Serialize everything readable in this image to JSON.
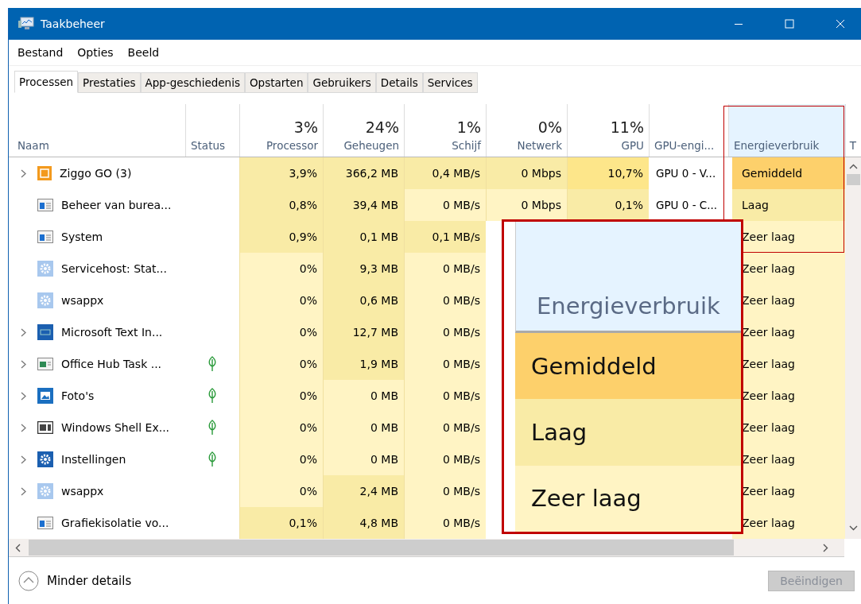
{
  "window": {
    "title": "Taakbeheer"
  },
  "menu": [
    "Bestand",
    "Opties",
    "Beeld"
  ],
  "tabs": [
    {
      "label": "Processen",
      "selected": true
    },
    {
      "label": "Prestaties",
      "selected": false
    },
    {
      "label": "App-geschiedenis",
      "selected": false
    },
    {
      "label": "Opstarten",
      "selected": false
    },
    {
      "label": "Gebruikers",
      "selected": false
    },
    {
      "label": "Details",
      "selected": false
    },
    {
      "label": "Services",
      "selected": false
    }
  ],
  "columns": [
    {
      "label": "Naam",
      "selected": false
    },
    {
      "label": "Status",
      "selected": false
    },
    {
      "label": "Processor",
      "total": "3%",
      "selected": false
    },
    {
      "label": "Geheugen",
      "total": "24%",
      "selected": false
    },
    {
      "label": "Schijf",
      "total": "1%",
      "selected": false
    },
    {
      "label": "Netwerk",
      "total": "0%",
      "selected": false
    },
    {
      "label": "GPU",
      "total": "11%",
      "selected": false
    },
    {
      "label": "GPU-engi...",
      "selected": false
    },
    {
      "label": "Energieverbruik",
      "selected": true
    },
    {
      "label": "T",
      "selected": false
    }
  ],
  "rows": [
    {
      "name": "Ziggo GO (3)",
      "kind": "ziggo",
      "expandable": true,
      "suspended": false,
      "processor": {
        "text": "3,9%",
        "color": "#f9eba6"
      },
      "memory": {
        "text": "366,2 MB",
        "color": "#f9eba6"
      },
      "disk": {
        "text": "0,4 MB/s",
        "color": "#f9eba6"
      },
      "network": {
        "text": "0 Mbps",
        "color": "#f9eba6"
      },
      "gpu": {
        "text": "10,7%",
        "color": "#fde68a"
      },
      "gpu_engine": "GPU 0 - V...",
      "energy": {
        "text": "Gemiddeld",
        "color": "#fdd06b"
      }
    },
    {
      "name": "Beheer van burea...",
      "kind": "window",
      "expandable": false,
      "suspended": false,
      "processor": {
        "text": "0,8%",
        "color": "#f9eba6"
      },
      "memory": {
        "text": "39,4 MB",
        "color": "#f9eba6"
      },
      "disk": {
        "text": "0 MB/s",
        "color": "#fff4c4"
      },
      "network": {
        "text": "0 Mbps",
        "color": "#fff4c4"
      },
      "gpu": {
        "text": "0,1%",
        "color": "#f9eba6"
      },
      "gpu_engine": "GPU 0 - C...",
      "energy": {
        "text": "Laag",
        "color": "#f9eba6"
      }
    },
    {
      "name": "System",
      "kind": "window",
      "expandable": false,
      "suspended": false,
      "processor": {
        "text": "0,9%",
        "color": "#f9eba6"
      },
      "memory": {
        "text": "0,1 MB",
        "color": "#f9eba6"
      },
      "disk": {
        "text": "0,1 MB/s",
        "color": "#f9eba6"
      },
      "energy": {
        "text": "Zeer laag",
        "color": "#fff4c4"
      }
    },
    {
      "name": "Servicehost: Stat...",
      "kind": "gear",
      "expandable": false,
      "suspended": false,
      "processor": {
        "text": "0%",
        "color": "#fff4c4"
      },
      "memory": {
        "text": "9,3 MB",
        "color": "#f9eba6"
      },
      "disk": {
        "text": "0 MB/s",
        "color": "#fff4c4"
      },
      "energy": {
        "text": "Zeer laag",
        "color": "#fff4c4"
      }
    },
    {
      "name": "wsappx",
      "kind": "gear",
      "expandable": false,
      "suspended": false,
      "processor": {
        "text": "0%",
        "color": "#fff4c4"
      },
      "memory": {
        "text": "0,6 MB",
        "color": "#f9eba6"
      },
      "disk": {
        "text": "0 MB/s",
        "color": "#fff4c4"
      },
      "energy": {
        "text": "Zeer laag",
        "color": "#fff4c4"
      }
    },
    {
      "name": "Microsoft Text In...",
      "kind": "keyboard",
      "expandable": true,
      "suspended": false,
      "processor": {
        "text": "0%",
        "color": "#fff4c4"
      },
      "memory": {
        "text": "12,7 MB",
        "color": "#f9eba6"
      },
      "disk": {
        "text": "0 MB/s",
        "color": "#fff4c4"
      },
      "energy": {
        "text": "Zeer laag",
        "color": "#fff4c4"
      }
    },
    {
      "name": "Office Hub Task ...",
      "kind": "app",
      "expandable": true,
      "suspended": true,
      "processor": {
        "text": "0%",
        "color": "#fff4c4"
      },
      "memory": {
        "text": "1,9 MB",
        "color": "#f9eba6"
      },
      "disk": {
        "text": "0 MB/s",
        "color": "#fff4c4"
      },
      "energy": {
        "text": "Zeer laag",
        "color": "#fff4c4"
      }
    },
    {
      "name": "Foto's",
      "kind": "photo",
      "expandable": true,
      "suspended": true,
      "processor": {
        "text": "0%",
        "color": "#fff4c4"
      },
      "memory": {
        "text": "0 MB",
        "color": "#fff4c4"
      },
      "disk": {
        "text": "0 MB/s",
        "color": "#fff4c4"
      },
      "energy": {
        "text": "Zeer laag",
        "color": "#fff4c4"
      }
    },
    {
      "name": "Windows Shell Ex...",
      "kind": "shell",
      "expandable": true,
      "suspended": true,
      "processor": {
        "text": "0%",
        "color": "#fff4c4"
      },
      "memory": {
        "text": "0 MB",
        "color": "#fff4c4"
      },
      "disk": {
        "text": "0 MB/s",
        "color": "#fff4c4"
      },
      "energy": {
        "text": "Zeer laag",
        "color": "#fff4c4"
      }
    },
    {
      "name": "Instellingen",
      "kind": "settings",
      "expandable": true,
      "suspended": true,
      "processor": {
        "text": "0%",
        "color": "#fff4c4"
      },
      "memory": {
        "text": "0 MB",
        "color": "#fff4c4"
      },
      "disk": {
        "text": "0 MB/s",
        "color": "#fff4c4"
      },
      "energy": {
        "text": "Zeer laag",
        "color": "#fff4c4"
      }
    },
    {
      "name": "wsappx",
      "kind": "gear",
      "expandable": true,
      "suspended": false,
      "processor": {
        "text": "0%",
        "color": "#fff4c4"
      },
      "memory": {
        "text": "2,4 MB",
        "color": "#f9eba6"
      },
      "disk": {
        "text": "0 MB/s",
        "color": "#fff4c4"
      },
      "energy": {
        "text": "Zeer laag",
        "color": "#fff4c4"
      }
    },
    {
      "name": "Grafiekisolatie vo...",
      "kind": "window",
      "expandable": false,
      "suspended": false,
      "processor": {
        "text": "0,1%",
        "color": "#f9eba6"
      },
      "memory": {
        "text": "4,8 MB",
        "color": "#f9eba6"
      },
      "disk": {
        "text": "0 MB/s",
        "color": "#fff4c4"
      },
      "energy": {
        "text": "Zeer laag",
        "color": "#fff4c4"
      }
    }
  ],
  "zoom_callout": {
    "header": "Energieverbruik",
    "items": [
      {
        "text": "Gemiddeld",
        "color": "#fdd06b"
      },
      {
        "text": "Laag",
        "color": "#f9eba6"
      },
      {
        "text": "Zeer laag",
        "color": "#fff4c4"
      }
    ]
  },
  "footer": {
    "toggle": "Minder details",
    "end_button": {
      "label": "Beëindigen",
      "disabled": true
    }
  }
}
